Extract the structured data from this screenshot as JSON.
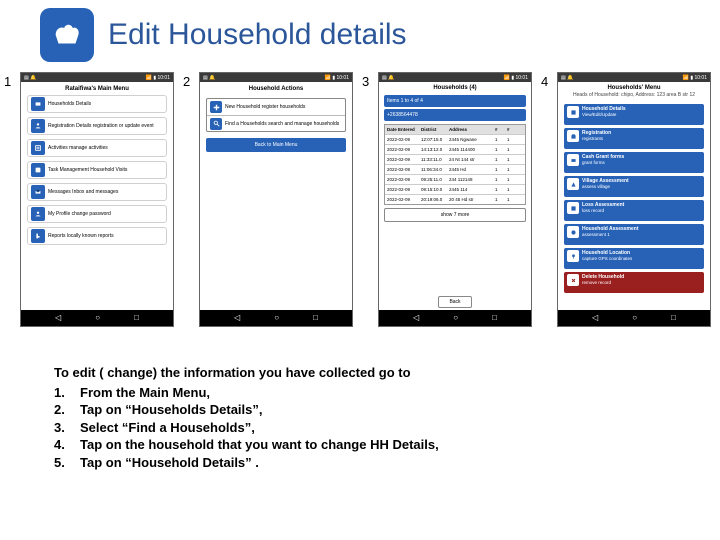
{
  "header": {
    "title": "Edit Household details"
  },
  "screens": {
    "numbers": [
      "1",
      "2",
      "3",
      "4"
    ],
    "status": {
      "left": "▤ 🔔",
      "right": "📶 ▮ 10:01"
    },
    "nav": {
      "back": "◁",
      "home": "○",
      "recent": "□"
    },
    "s1": {
      "title": "Rataifiwa's Main Menu",
      "items": [
        "Households Details",
        "Registration Details registration or update event",
        "Activities manage activities",
        "Task Management Household Visits",
        "Messages Inbox and messages",
        "My Profile change password",
        "Reports locally known reports"
      ]
    },
    "s2": {
      "title": "Household Actions",
      "btn1": "New Household register households",
      "btn2": "Find a Households search and manage households",
      "back": "Back to Main Menu"
    },
    "s3": {
      "title": "Households (4)",
      "bar1": "Items 1 to 4 of 4",
      "bar2": "+2638564478",
      "head": [
        "Date Entered",
        "District",
        "Address",
        "#",
        "#"
      ],
      "rows": [
        [
          "2022-02-09",
          "12:07:15.0",
          "2445 Ngwane",
          "1",
          "1"
        ],
        [
          "2022-02-09",
          "14:13:12.0",
          "2445 114400",
          "1",
          "1"
        ],
        [
          "2022-02-09",
          "11:33:11.0",
          "24 Nt 144 str",
          "1",
          "1"
        ],
        [
          "2022-02-09",
          "11:06:34.0",
          "2445 Hd",
          "1",
          "1"
        ],
        [
          "2022-02-09",
          "09:25:11.0",
          "244 112148",
          "1",
          "1"
        ],
        [
          "2022-02-09",
          "09:15:10.0",
          "2445 114",
          "1",
          "1"
        ],
        [
          "2022-02-09",
          "20:19:06.0",
          "20 45 Hd str",
          "1",
          "1"
        ]
      ],
      "show": "show 7 more",
      "back": "Back"
    },
    "s4": {
      "title": "Households' Menu",
      "sub": "Heads of Household: chipo, Address: 123 area B str 12",
      "items": [
        {
          "t": "Household Details",
          "d": "View/Edit/Update"
        },
        {
          "t": "Registration",
          "d": "registrants"
        },
        {
          "t": "Cash Grant forms",
          "d": "grant forms"
        },
        {
          "t": "Village Assessment",
          "d": "assess village"
        },
        {
          "t": "Loss Assessment",
          "d": "loss record"
        },
        {
          "t": "Household Assessment",
          "d": "assessment 1"
        },
        {
          "t": "Household Location",
          "d": "capture GPS coordinates"
        },
        {
          "t": "Delete Household",
          "d": "remove record",
          "del": true
        }
      ]
    }
  },
  "instructions": {
    "lede": "To edit ( change) the information you have collected  go to",
    "steps": [
      "From the Main Menu,",
      "Tap on “Households Details”,",
      "Select “Find a Households”,",
      "Tap on the household that you want to change HH Details,",
      "Tap on “Household Details” ."
    ]
  }
}
